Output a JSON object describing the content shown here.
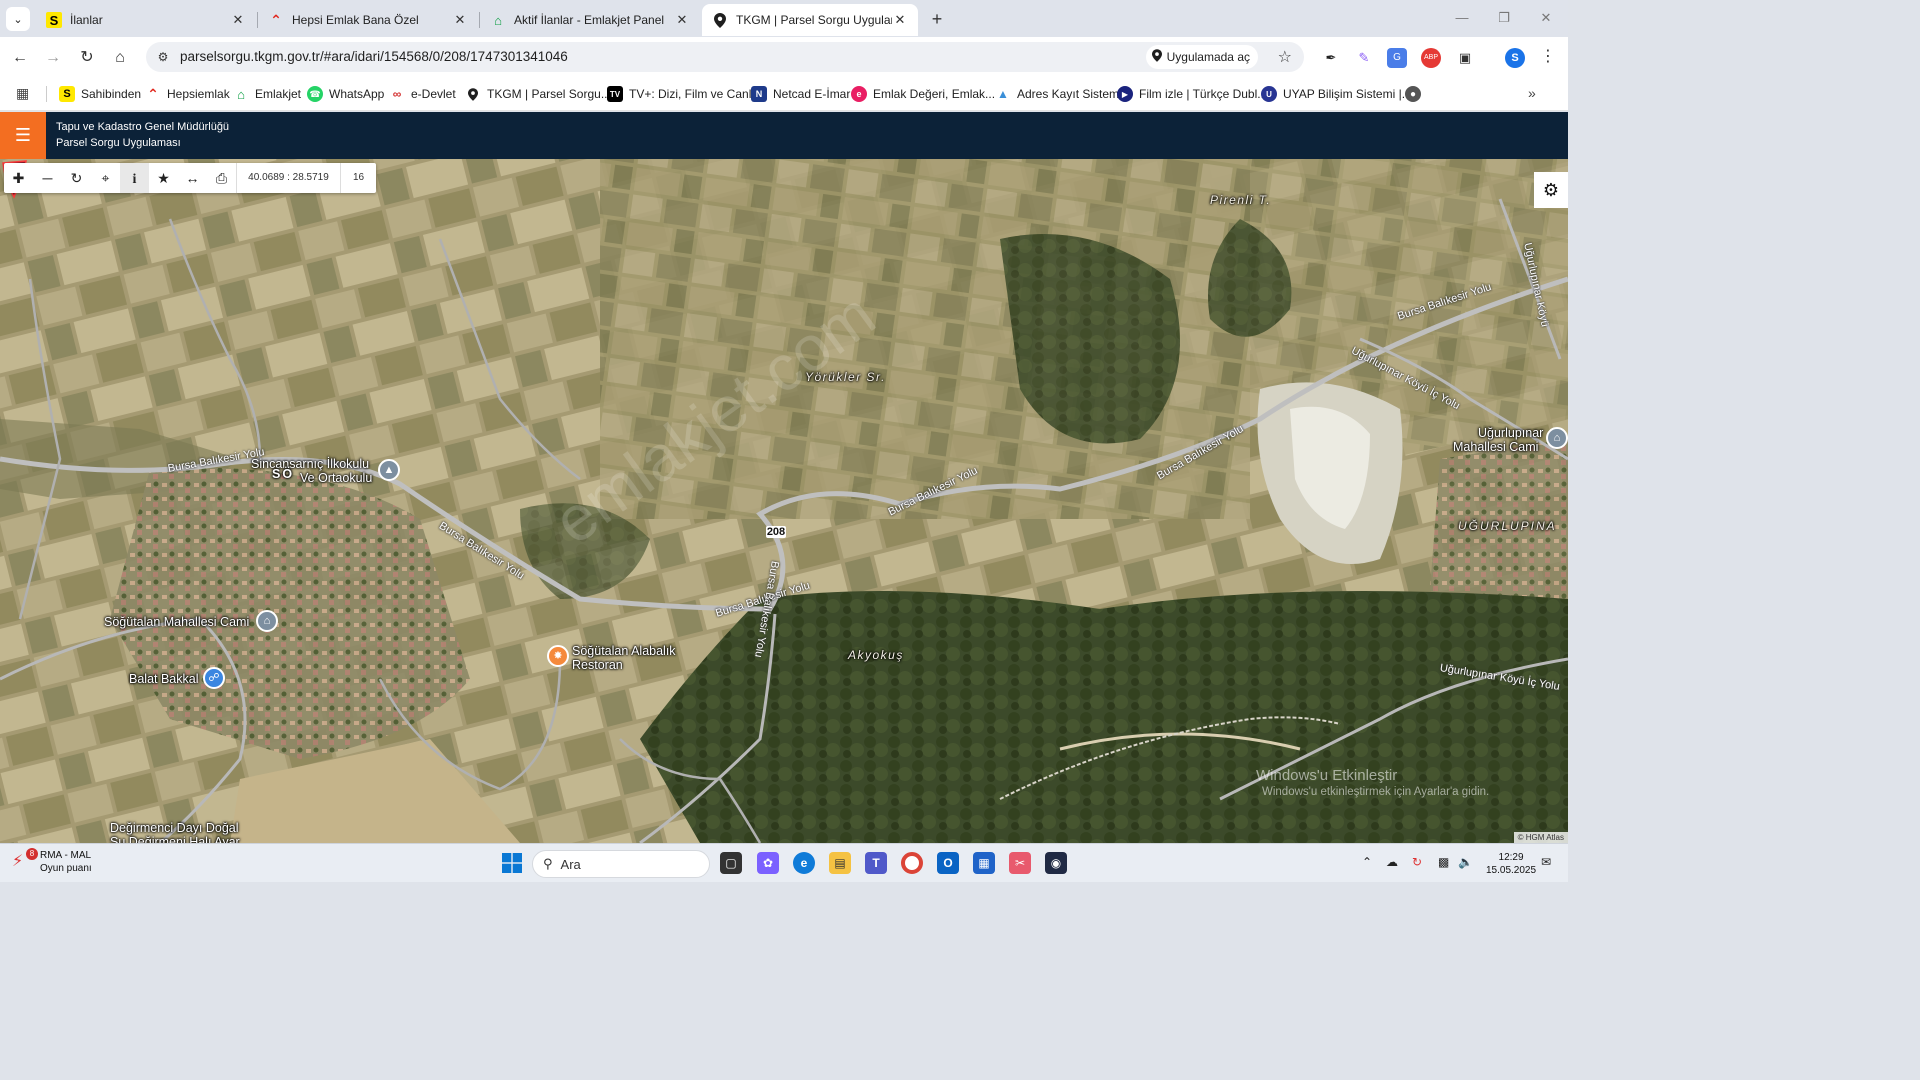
{
  "browser": {
    "tabs": [
      {
        "label": "İlanlar",
        "active": false
      },
      {
        "label": "Hepsi Emlak Bana Özel",
        "active": false
      },
      {
        "label": "Aktif İlanlar - Emlakjet Panel",
        "active": false
      },
      {
        "label": "TKGM | Parsel Sorgu Uygulaması",
        "active": true
      }
    ],
    "url": "parselsorgu.tkgm.gov.tr/#ara/idari/154568/0/208/1747301341046",
    "open_in_app_label": "Uygulamada aç",
    "profile_initial": "S",
    "bookmarks": [
      "Sahibinden",
      "Hepsiemlak",
      "Emlakjet",
      "WhatsApp",
      "e-Devlet",
      "TKGM | Parsel Sorgu...",
      "TV+: Dizi, Film ve Canl...",
      "Netcad E-İmar",
      "Emlak Değeri, Emlak...",
      "Adres Kayıt Sistemi",
      "Film izle | Türkçe Dubl...",
      "UYAP Bilişim Sistemi |..."
    ]
  },
  "app": {
    "title_line1": "Tapu ve Kadastro Genel Müdürlüğü",
    "title_line2": "Parsel Sorgu Uygulaması",
    "accent_color": "#f36e21",
    "header_color": "#0c2238"
  },
  "map": {
    "coordinates": "40.0689 : 28.5719",
    "zoom_level": "16",
    "parcel_number": "208",
    "watermark": "emlakjet.com",
    "labels": {
      "pirenli": "Pirenli T.",
      "yorukler": "Yörükler Sr.",
      "akyokus": "Akyokuş",
      "ugurlupinar": "UĞURLUPINA",
      "ugurlupinar_cami_1": "Uğurlupınar",
      "ugurlupinar_cami_2": "Mahallesi Cami",
      "school_1": "Sincansarnıç İlkokulu",
      "school_2": "Ve Ortaokulu",
      "school_prefix": "SÖ",
      "sogutalan_cami": "Söğütalan Mahallesi Cami",
      "balat": "Balat Bakkal",
      "restoran_1": "Söğütalan Alabalık",
      "restoran_2": "Restoran",
      "degirmen_1": "Değirmenci Dayı Doğal",
      "degirmen_2": "Su Değirmeni Halı Ayar"
    },
    "roads": {
      "r1": "Bursa Balıkesir Yolu",
      "r2": "Bursa Balıkesir Yolu",
      "r3": "Bursa Balıkesir Yolu",
      "r4": "Bursa Balıkesir Yolu",
      "r5": "Bursa Balıkesir Yolu",
      "r6": "Bursa Balıkesir Yolu",
      "r7": "Bursa Balıkesir Yolu",
      "r8": "Uğurlupınar Köyü İç Yolu",
      "r9": "Uğurlupınar Köyü İç Yolu",
      "r10": "Uğurlupınar Köyü"
    },
    "windows_activation_1": "Windows'u Etkinleştir",
    "windows_activation_2": "Windows'u etkinleştirmek için Ayarlar'a gidin.",
    "attribution": "© HGM Atlas"
  },
  "taskbar": {
    "weather_badge": "8",
    "weather_title": "RMA - MAL",
    "weather_sub": "Oyun puanı",
    "search_placeholder": "Ara",
    "time": "12:29",
    "date": "15.05.2025"
  }
}
